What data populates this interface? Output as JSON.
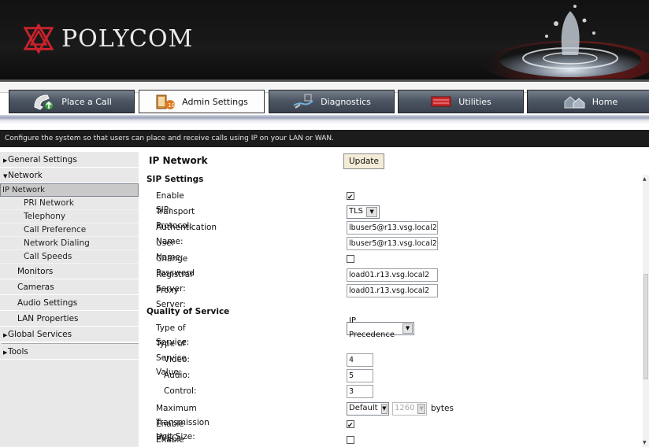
{
  "brand": {
    "name": "POLYCOM"
  },
  "nav": {
    "tabs": [
      {
        "label": "Place a Call",
        "icon": "phone-icon"
      },
      {
        "label": "Admin Settings",
        "icon": "admin-settings-icon"
      },
      {
        "label": "Diagnostics",
        "icon": "diagnostics-icon"
      },
      {
        "label": "Utilities",
        "icon": "utilities-icon"
      },
      {
        "label": "Home",
        "icon": "home-icon"
      }
    ],
    "active": "Admin Settings"
  },
  "description": "Configure the system so that users can place and receive calls using IP on your LAN or WAN.",
  "sidebar": {
    "general_settings": "General Settings",
    "network": "Network",
    "network_items": [
      "IP Network",
      "PRI Network",
      "Telephony",
      "Call Preference",
      "Network Dialing",
      "Call Speeds"
    ],
    "selected": "IP Network",
    "monitors": "Monitors",
    "cameras": "Cameras",
    "audio_settings": "Audio Settings",
    "lan_properties": "LAN Properties",
    "global_services": "Global Services",
    "tools": "Tools"
  },
  "page": {
    "title": "IP Network",
    "update_label": "Update",
    "sip": {
      "heading": "SIP Settings",
      "enable_sip_label": "Enable SIP:",
      "enable_sip": true,
      "transport_label": "Transport Protocol:",
      "transport_value": "TLS",
      "auth_name_label": "Authentication Name:",
      "auth_name_value": "lbuser5@r13.vsg.local2",
      "user_name_label": "User Name:",
      "user_name_value": "lbuser5@r13.vsg.local2",
      "change_password_label": "Change Password",
      "change_password": false,
      "registrar_label": "Registrar Server:",
      "registrar_value": "load01.r13.vsg.local2",
      "proxy_label": "Proxy Server:",
      "proxy_value": "load01.r13.vsg.local2"
    },
    "qos": {
      "heading": "Quality of Service",
      "tos_label": "Type of Service:",
      "tos_value": "IP Precedence",
      "tos_value_label": "Type of Service Value:",
      "video_label": "Video:",
      "video_value": "4",
      "audio_label": "Audio:",
      "audio_value": "5",
      "control_label": "Control:",
      "control_value": "3",
      "mtu_label": "Maximum Transmission Unit Size:",
      "mtu_mode": "Default",
      "mtu_size": "1260",
      "mtu_unit": "bytes",
      "pvec_label": "Enable PVEC:",
      "pvec": true,
      "rsvp_label": "Enable RSVP:",
      "rsvp": false
    }
  },
  "colors": {
    "brand_red": "#c8232c",
    "header_bg": "#141414",
    "nav_dark": "#4d5663",
    "sidebar_bg": "#e8e8e8"
  }
}
